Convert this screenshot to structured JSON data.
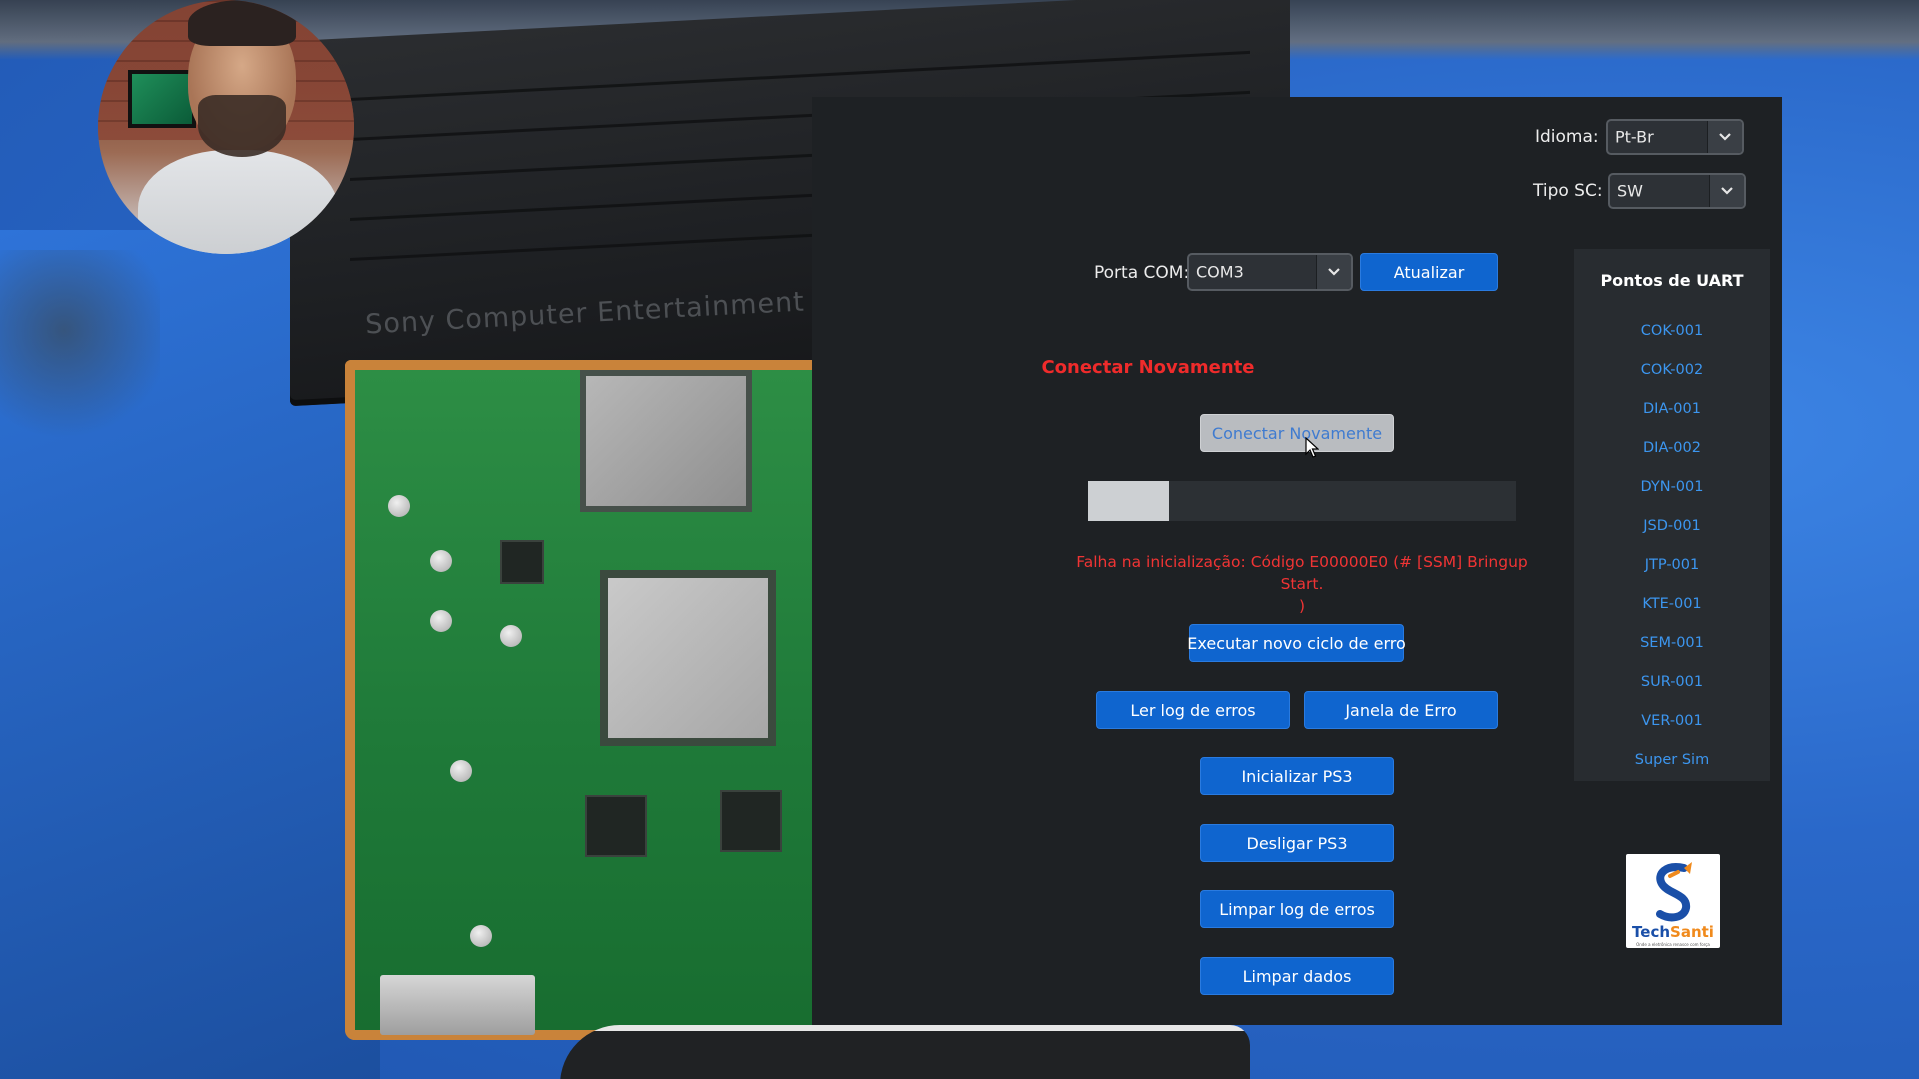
{
  "scene": {
    "console_brand": "Sony Computer Entertainment"
  },
  "settings": {
    "language_label": "Idioma:",
    "language_value": "Pt-Br",
    "sc_type_label": "Tipo SC:",
    "sc_type_value": "SW"
  },
  "connection": {
    "port_label": "Porta COM:",
    "port_value": "COM3",
    "refresh_label": "Atualizar",
    "status_title": "Conectar Novamente",
    "reconnect_label": "Conectar Novamente",
    "progress": 0.19,
    "error_message": "Falha na inicialização: Código E00000E0 (# [SSM] Bringup Start.\n)"
  },
  "actions": {
    "run_error_cycle": "Executar novo ciclo de erro",
    "read_error_log": "Ler log de erros",
    "error_window": "Janela de Erro",
    "init_ps3": "Inicializar PS3",
    "shutdown_ps3": "Desligar PS3",
    "clear_error_log": "Limpar log de erros",
    "clear_data": "Limpar dados"
  },
  "uart": {
    "title": "Pontos de UART",
    "items": [
      "COK-001",
      "COK-002",
      "DIA-001",
      "DIA-002",
      "DYN-001",
      "JSD-001",
      "JTP-001",
      "KTE-001",
      "SEM-001",
      "SUR-001",
      "VER-001",
      "Super Sim"
    ]
  },
  "logo": {
    "brand_text": "TechSanti",
    "tagline": "Onde a eletrônica renasce com força"
  },
  "colors": {
    "app_bg": "#1e2124",
    "button_blue": "#0f65cf",
    "error_red": "#ef2b2b",
    "link_blue": "#3c96ef"
  },
  "icons": {
    "dropdown": "chevron-down-icon",
    "cursor": "mouse-pointer-icon",
    "logo": "techsanti-s-logo"
  }
}
